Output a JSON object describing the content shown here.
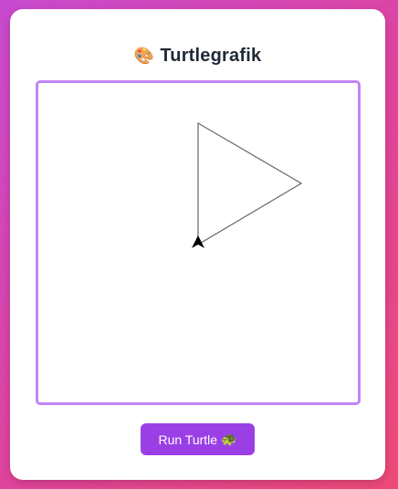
{
  "app": {
    "title": "Turtlegrafik",
    "title_icon": "🎨",
    "title_icon_name": "palette-icon"
  },
  "canvas": {
    "stroke_color": "#666666",
    "turtle_color": "#000000",
    "border_color": "#c086f5"
  },
  "controls": {
    "run_label": "Run Turtle",
    "run_icon": "🐢",
    "run_icon_name": "turtle-icon",
    "button_color": "#9a3fe6"
  },
  "theme": {
    "gradient_start": "#c84ad0",
    "gradient_end": "#ee4a78"
  }
}
